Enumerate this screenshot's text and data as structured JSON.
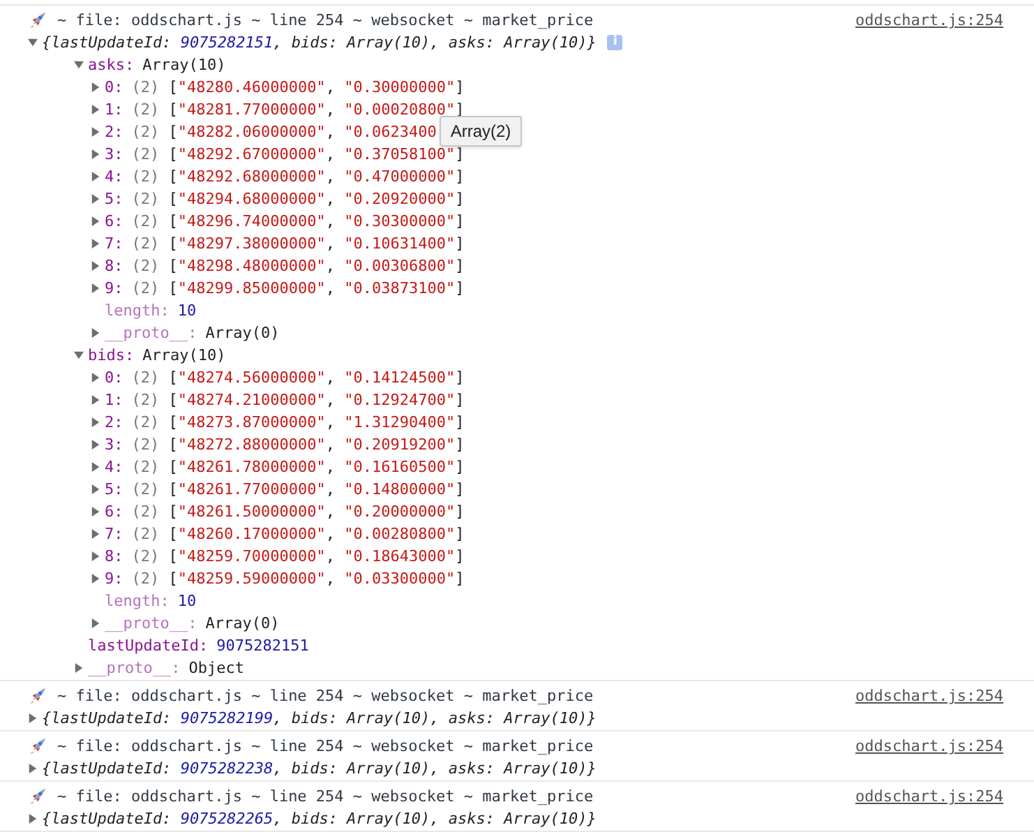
{
  "messages": [
    {
      "kind": "log",
      "header": "~ file: oddschart.js ~ line 254 ~ websocket ~ market_price",
      "source": "oddschart.js:254",
      "summary": "{lastUpdateId: 9075282151, bids: Array(10), asks: Array(10)}",
      "info_badge": "i",
      "expanded": true,
      "children": [
        {
          "key": "asks:",
          "kind": "own",
          "value": "Array(10)",
          "expanded": true,
          "children": [
            {
              "key": "0:",
              "kind": "own",
              "value": "(2) [\"48280.46000000\", \"0.30000000\"]",
              "expanded": false
            },
            {
              "key": "1:",
              "kind": "own",
              "value": "(2) [\"48281.77000000\", \"0.00020800\"]",
              "expanded": false
            },
            {
              "key": "2:",
              "kind": "own",
              "value": "(2) [\"48282.06000000\", \"0.0623400",
              "expanded": false,
              "tooltip": "Array(2)"
            },
            {
              "key": "3:",
              "kind": "own",
              "value": "(2) [\"48292.67000000\", \"0.37058100\"]",
              "expanded": false
            },
            {
              "key": "4:",
              "kind": "own",
              "value": "(2) [\"48292.68000000\", \"0.47000000\"]",
              "expanded": false
            },
            {
              "key": "5:",
              "kind": "own",
              "value": "(2) [\"48294.68000000\", \"0.20920000\"]",
              "expanded": false
            },
            {
              "key": "6:",
              "kind": "own",
              "value": "(2) [\"48296.74000000\", \"0.30300000\"]",
              "expanded": false
            },
            {
              "key": "7:",
              "kind": "own",
              "value": "(2) [\"48297.38000000\", \"0.10631400\"]",
              "expanded": false
            },
            {
              "key": "8:",
              "kind": "own",
              "value": "(2) [\"48298.48000000\", \"0.00306800\"]",
              "expanded": false
            },
            {
              "key": "9:",
              "kind": "own",
              "value": "(2) [\"48299.85000000\", \"0.03873100\"]",
              "expanded": false
            },
            {
              "key": "length:",
              "kind": "internal",
              "value": "10"
            },
            {
              "key": "__proto__:",
              "kind": "internal",
              "value": "Array(0)",
              "expanded": false
            }
          ]
        },
        {
          "key": "bids:",
          "kind": "own",
          "value": "Array(10)",
          "expanded": true,
          "children": [
            {
              "key": "0:",
              "kind": "own",
              "value": "(2) [\"48274.56000000\", \"0.14124500\"]",
              "expanded": false
            },
            {
              "key": "1:",
              "kind": "own",
              "value": "(2) [\"48274.21000000\", \"0.12924700\"]",
              "expanded": false
            },
            {
              "key": "2:",
              "kind": "own",
              "value": "(2) [\"48273.87000000\", \"1.31290400\"]",
              "expanded": false
            },
            {
              "key": "3:",
              "kind": "own",
              "value": "(2) [\"48272.88000000\", \"0.20919200\"]",
              "expanded": false
            },
            {
              "key": "4:",
              "kind": "own",
              "value": "(2) [\"48261.78000000\", \"0.16160500\"]",
              "expanded": false
            },
            {
              "key": "5:",
              "kind": "own",
              "value": "(2) [\"48261.77000000\", \"0.14800000\"]",
              "expanded": false
            },
            {
              "key": "6:",
              "kind": "own",
              "value": "(2) [\"48261.50000000\", \"0.20000000\"]",
              "expanded": false
            },
            {
              "key": "7:",
              "kind": "own",
              "value": "(2) [\"48260.17000000\", \"0.00280800\"]",
              "expanded": false
            },
            {
              "key": "8:",
              "kind": "own",
              "value": "(2) [\"48259.70000000\", \"0.18643000\"]",
              "expanded": false
            },
            {
              "key": "9:",
              "kind": "own",
              "value": "(2) [\"48259.59000000\", \"0.03300000\"]",
              "expanded": false
            },
            {
              "key": "length:",
              "kind": "internal",
              "value": "10"
            },
            {
              "key": "__proto__:",
              "kind": "internal",
              "value": "Array(0)",
              "expanded": false
            }
          ]
        },
        {
          "key": "lastUpdateId:",
          "kind": "own",
          "value": "9075282151"
        },
        {
          "key": "__proto__:",
          "kind": "internal",
          "value": "Object",
          "expanded": false
        }
      ]
    },
    {
      "kind": "log",
      "header": "~ file: oddschart.js ~ line 254 ~ websocket ~ market_price",
      "source": "oddschart.js:254",
      "summary": "{lastUpdateId: 9075282199, bids: Array(10), asks: Array(10)}",
      "expanded": false
    },
    {
      "kind": "log",
      "header": "~ file: oddschart.js ~ line 254 ~ websocket ~ market_price",
      "source": "oddschart.js:254",
      "summary": "{lastUpdateId: 9075282238, bids: Array(10), asks: Array(10)}",
      "expanded": false
    },
    {
      "kind": "log",
      "header": "~ file: oddschart.js ~ line 254 ~ websocket ~ market_price",
      "source": "oddschart.js:254",
      "summary": "{lastUpdateId: 9075282265, bids: Array(10), asks: Array(10)}",
      "expanded": false
    }
  ]
}
